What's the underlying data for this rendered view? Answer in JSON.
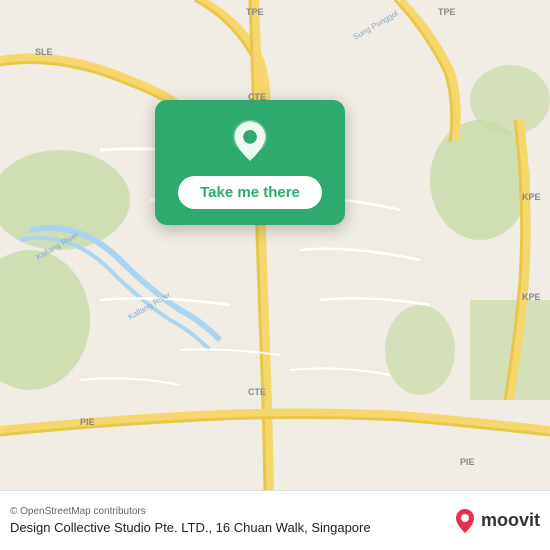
{
  "map": {
    "background_color": "#e8e0d8"
  },
  "action_card": {
    "button_label": "Take me there",
    "pin_icon_name": "location-pin-icon"
  },
  "footer": {
    "copyright": "© OpenStreetMap contributors",
    "location_name": "Design Collective Studio Pte. LTD., 16 Chuan Walk,",
    "location_city": "Singapore",
    "brand_name": "moovit"
  }
}
